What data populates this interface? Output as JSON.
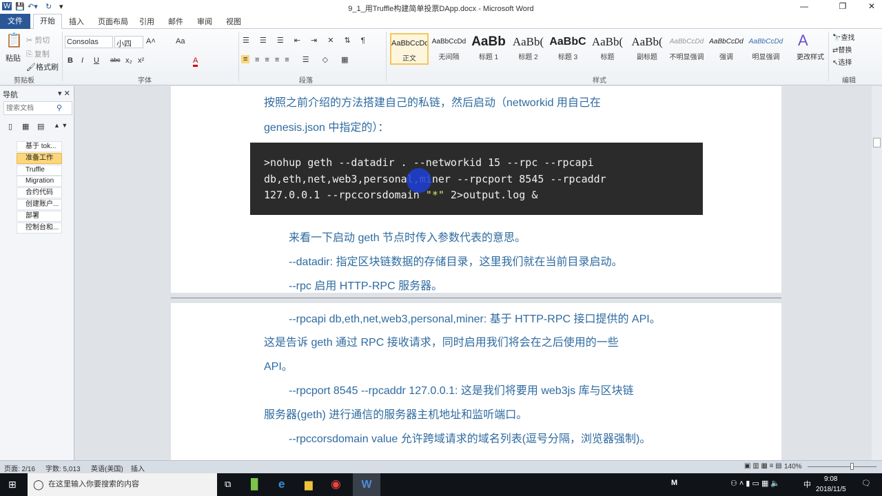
{
  "window": {
    "title": "9_1_用Truffle构建简单投票DApp.docx - Microsoft Word",
    "minimize": "—",
    "restore": "❐",
    "close": "✕"
  },
  "tabs": [
    "文件",
    "开始",
    "插入",
    "页面布局",
    "引用",
    "邮件",
    "审阅",
    "视图"
  ],
  "ribbon": {
    "clipboard": {
      "paste": "粘贴",
      "cut": "剪切",
      "copy": "复制",
      "format_painter": "格式刷",
      "label": "剪贴板"
    },
    "font": {
      "name": "Consolas",
      "size": "小四",
      "label": "字体",
      "bold": "B",
      "italic": "I",
      "underline": "U",
      "strike": "abc",
      "sub": "x₂",
      "sup": "x²",
      "grow": "A˄",
      "shrink": "A˅",
      "case": "Aa",
      "color": "A"
    },
    "paragraph": {
      "label": "段落"
    },
    "styles": {
      "label": "样式",
      "items": [
        {
          "sample": "AaBbCcDd",
          "name": "正文"
        },
        {
          "sample": "AaBbCcDd",
          "name": "无间隔"
        },
        {
          "sample": "AaBb",
          "name": "标题 1"
        },
        {
          "sample": "AaBb(",
          "name": "标题 2"
        },
        {
          "sample": "AaBbC",
          "name": "标题 3"
        },
        {
          "sample": "AaBb(",
          "name": "标题"
        },
        {
          "sample": "AaBb(",
          "name": "副标题"
        },
        {
          "sample": "AaBbCcDd",
          "name": "不明显强调"
        },
        {
          "sample": "AaBbCcDd",
          "name": "强调"
        },
        {
          "sample": "AaBbCcDd",
          "name": "明显强调"
        }
      ],
      "change": "更改样式"
    },
    "editing": {
      "find": "查找",
      "replace": "替换",
      "select": "选择",
      "label": "编辑"
    }
  },
  "nav": {
    "title": "导航",
    "search_placeholder": "搜索文档",
    "items": [
      "基于 tok...",
      "准备工作",
      "Truffle",
      "Migration",
      "合约代码",
      "创建账户...",
      "部署",
      "控制台和..."
    ],
    "active": 1
  },
  "doc": {
    "p1": "按照之前介绍的方法搭建自己的私链，然后启动（networkid  用自己在",
    "p2": "genesis.json  中指定的）：",
    "code1": ">nohup geth --datadir . --networkid 15 --rpc --rpcapi",
    "code2": "db,eth,net,web3,personal,miner  --rpcport 8545 --rpcaddr",
    "code3a": "127.0.0.1 --rpccorsdomain ",
    "code3b": "\"*\"",
    "code3c": " 2>output.log &",
    "p3": "来看一下启动  geth  节点时传入参数代表的意思。",
    "p4": "--datadir:  指定区块链数据的存储目录，这里我们就在当前目录启动。",
    "p5": "--rpc  启用 HTTP-RPC 服务器。",
    "p6": "--rpcapi db,eth,net,web3,personal,miner:  基于 HTTP-RPC 接口提供的 API。",
    "p7": "这是告诉  geth  通过  RPC  接收请求，同时启用我们将会在之后使用的一些",
    "p8": "API。",
    "p9": "--rpcport  8545  --rpcaddr  127.0.0.1:  这是我们将要用  web3js  库与区块链",
    "p10": "服务器(geth)  进行通信的服务器主机地址和监听端口。",
    "p11": "--rpccorsdomain value  允许跨域请求的域名列表(逗号分隔，浏览器强制)。"
  },
  "status": {
    "page": "页面: 2/16",
    "words": "字数: 5,013",
    "lang": "英语(美国)",
    "mode": "插入",
    "zoom": "140%"
  },
  "taskbar": {
    "search": "在这里输入你要搜索的内容",
    "time": "9:08",
    "date": "2018/11/5",
    "ime": "中"
  },
  "colors": {
    "doc_text": "#2e6ba0",
    "code_bg": "#2b2b2b",
    "accent": "#2b5797"
  }
}
